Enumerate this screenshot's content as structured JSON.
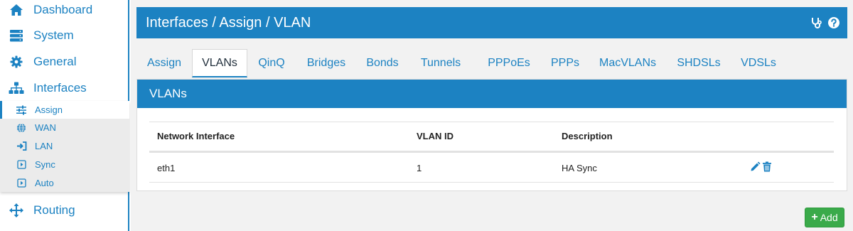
{
  "sidebar": {
    "items": [
      {
        "label": "Dashboard",
        "icon": "home-icon"
      },
      {
        "label": "System",
        "icon": "server-icon"
      },
      {
        "label": "General",
        "icon": "gear-icon"
      },
      {
        "label": "Interfaces",
        "icon": "sitemap-icon"
      },
      {
        "label": "Routing",
        "icon": "arrows-icon"
      }
    ],
    "submenu": [
      {
        "label": "Assign",
        "icon": "sliders-icon",
        "active": true
      },
      {
        "label": "WAN",
        "icon": "globe-icon"
      },
      {
        "label": "LAN",
        "icon": "sign-in-icon"
      },
      {
        "label": "Sync",
        "icon": "caret-square-icon"
      },
      {
        "label": "Auto",
        "icon": "caret-square-icon"
      }
    ]
  },
  "header": {
    "title": "Interfaces / Assign / VLAN",
    "icons": [
      "stethoscope-icon",
      "help-icon"
    ]
  },
  "tabs": [
    {
      "label": "Assign"
    },
    {
      "label": "VLANs",
      "active": true
    },
    {
      "label": "QinQ"
    },
    {
      "label": "Bridges"
    },
    {
      "label": "Bonds"
    },
    {
      "label": "Tunnels"
    },
    {
      "label": "PPPoEs"
    },
    {
      "label": "PPPs"
    },
    {
      "label": "MacVLANs"
    },
    {
      "label": "SHDSLs"
    },
    {
      "label": "VDSLs"
    }
  ],
  "panel": {
    "title": "VLANs",
    "columns": [
      "Network Interface",
      "VLAN ID",
      "Description"
    ],
    "rows": [
      {
        "interface": "eth1",
        "vlan_id": "1",
        "description": "HA Sync"
      }
    ]
  },
  "add_button": {
    "label": "Add"
  },
  "colors": {
    "accent": "#1c82c2",
    "add_button": "#3aaa4a",
    "main_background": "#f2f2f2",
    "submenu_background": "#ebebeb"
  }
}
